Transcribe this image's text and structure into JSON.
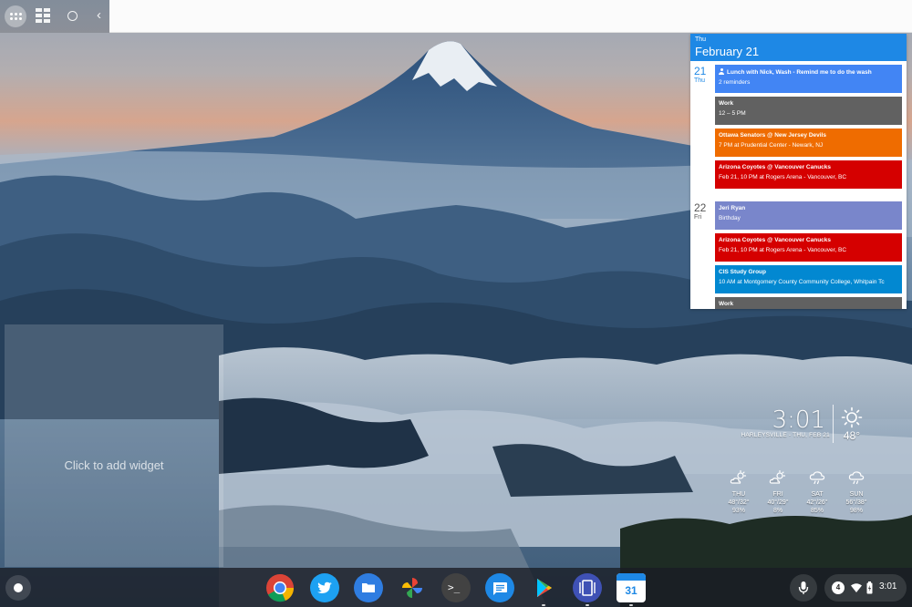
{
  "calendar": {
    "header_dow": "Thu",
    "header_date": "February 21",
    "days": [
      {
        "num": "21",
        "dow": "Thu",
        "today": true,
        "events": [
          {
            "title": "Lunch with Nick, Wash - Remind me to do the wash",
            "sub": "2 reminders",
            "color": "#4285f4",
            "icon": "person-icon"
          },
          {
            "title": "Work",
            "sub": "12 – 5 PM",
            "color": "#616161"
          },
          {
            "title": "Ottawa Senators @ New Jersey Devils",
            "sub": "7 PM at Prudential Center - Newark, NJ",
            "color": "#ef6c00"
          },
          {
            "title": "Arizona Coyotes @ Vancouver Canucks",
            "sub": "Feb 21, 10 PM at Rogers Arena - Vancouver, BC",
            "color": "#d50000"
          }
        ]
      },
      {
        "num": "22",
        "dow": "Fri",
        "today": false,
        "events": [
          {
            "title": "Jeri Ryan",
            "sub": "Birthday",
            "color": "#7986cb"
          },
          {
            "title": "Arizona Coyotes @ Vancouver Canucks",
            "sub": "Feb 21, 10 PM at Rogers Arena - Vancouver, BC",
            "color": "#d50000"
          },
          {
            "title": "CIS Study Group",
            "sub": "10 AM at Montgomery County Community College, Whitpain Tc",
            "color": "#0288d1"
          },
          {
            "title": "Work",
            "sub": "",
            "color": "#616161"
          }
        ]
      }
    ]
  },
  "add_widget": {
    "label": "Click to add widget"
  },
  "clock": {
    "time": "3:01",
    "location": "HARLEYSVILLE - THU, FEB 21"
  },
  "weather": {
    "now": {
      "temp": "48°",
      "icon": "sun-icon"
    },
    "forecast": [
      {
        "day": "THU",
        "temp": "48°/32°",
        "pct": "93%",
        "icon": "partly-sunny-icon"
      },
      {
        "day": "FRI",
        "temp": "40°/29°",
        "pct": "8%",
        "icon": "partly-sunny-icon"
      },
      {
        "day": "SAT",
        "temp": "42°/26°",
        "pct": "85%",
        "icon": "rain-cloud-icon"
      },
      {
        "day": "SUN",
        "temp": "56°/38°",
        "pct": "98%",
        "icon": "rain-cloud-icon"
      }
    ]
  },
  "shelf": {
    "apps": [
      {
        "name": "chrome-app-icon",
        "running": false
      },
      {
        "name": "twitter-app-icon",
        "running": false
      },
      {
        "name": "files-app-icon",
        "running": false
      },
      {
        "name": "photos-app-icon",
        "running": false
      },
      {
        "name": "terminal-app-icon",
        "running": false
      },
      {
        "name": "messages-app-icon",
        "running": false
      },
      {
        "name": "play-store-app-icon",
        "running": true
      },
      {
        "name": "overview-app-icon",
        "running": true
      },
      {
        "name": "calendar-app-icon",
        "running": true
      }
    ],
    "calendar_icon_day": "31",
    "terminal_prompt": ">_",
    "notification_count": "4",
    "time": "3:01"
  }
}
